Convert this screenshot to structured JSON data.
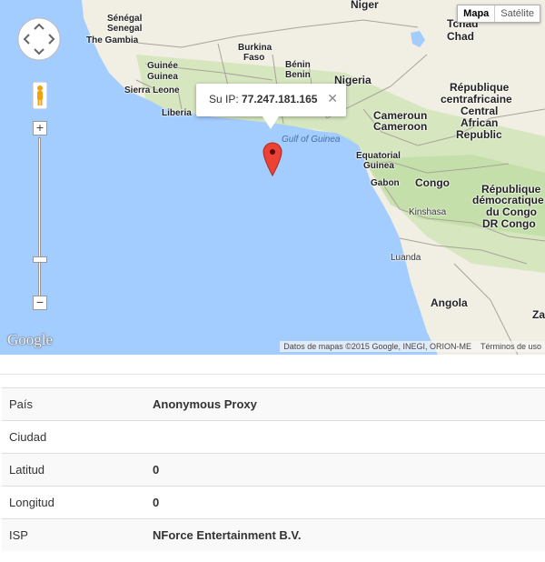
{
  "map": {
    "type_buttons": {
      "map": "Mapa",
      "satellite": "Satélite"
    },
    "popup": {
      "prefix": "Su IP: ",
      "ip": "77.247.181.165"
    },
    "attribution": {
      "data": "Datos de mapas ©2015 Google, INEGI, ORION-ME",
      "terms": "Términos de uso"
    },
    "logo": "Google",
    "labels": {
      "niger": "Niger",
      "senegal_fr": "Sénégal",
      "senegal": "Senegal",
      "gambia": "The Gambia",
      "burkina1": "Burkina",
      "burkina2": "Faso",
      "guinee": "Guinée",
      "guinea": "Guinea",
      "benin_fr": "Bénin",
      "benin": "Benin",
      "nigeria": "Nigeria",
      "sierra": "Sierra Leone",
      "liberia": "Liberia",
      "tchad": "Tchad",
      "chad": "Chad",
      "rca1": "République",
      "rca2": "centrafricaine",
      "rca3": "Central",
      "rca4": "African",
      "rca5": "Republic",
      "cameroun": "Cameroun",
      "cameroon": "Cameroon",
      "gulf": "Gulf of Guinea",
      "eqg1": "Equatorial",
      "eqg2": "Guinea",
      "gabon": "Gabon",
      "congo": "Congo",
      "rdc1": "République",
      "rdc2": "démocratique",
      "rdc3": "du Congo",
      "rdc4": "DR Congo",
      "kinshasa": "Kinshasa",
      "luanda": "Luanda",
      "angola": "Angola",
      "za": "Za"
    }
  },
  "details": [
    {
      "label": "País",
      "value": "Anonymous Proxy"
    },
    {
      "label": "Ciudad",
      "value": ""
    },
    {
      "label": "Latitud",
      "value": "0"
    },
    {
      "label": "Longitud",
      "value": "0"
    },
    {
      "label": "ISP",
      "value": "NForce Entertainment B.V."
    }
  ],
  "colors": {
    "ocean": "#a3ccff",
    "land": "#f1eee3",
    "forest": "#cfe4b5",
    "marker": "#ea4335"
  },
  "icons": [
    "pan-control-icon",
    "pegman-icon",
    "zoom-in-icon",
    "zoom-out-icon",
    "close-icon",
    "map-marker-icon"
  ]
}
